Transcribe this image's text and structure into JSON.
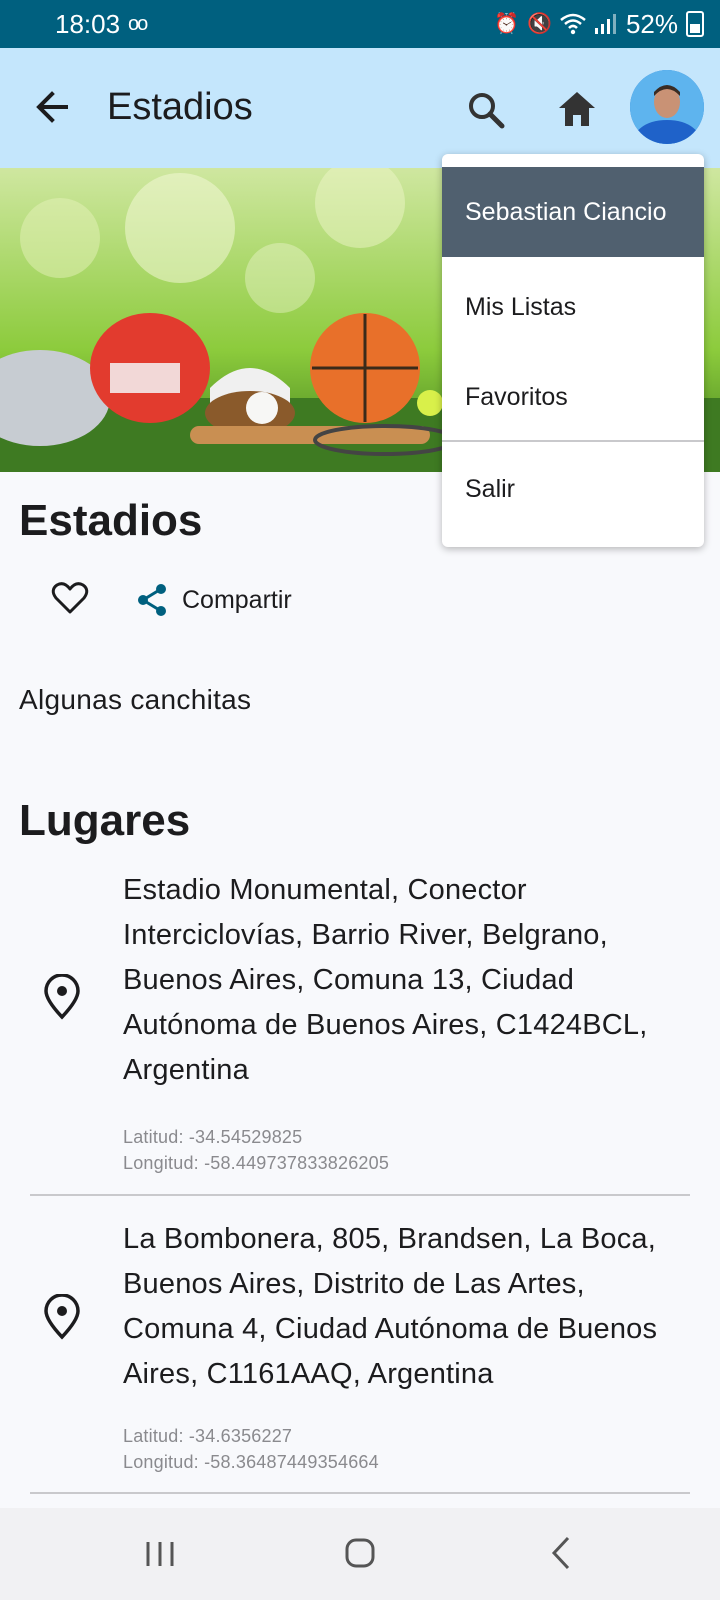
{
  "status_bar": {
    "time": "18:03",
    "battery": "52%"
  },
  "app_bar": {
    "title": "Estadios"
  },
  "list": {
    "title": "Estadios",
    "share_label": "Compartir",
    "description": "Algunas canchitas",
    "section_title": "Lugares"
  },
  "places": [
    {
      "address": "Estadio Monumental, Conector Interciclovías, Barrio River, Belgrano, Buenos Aires, Comuna 13, Ciudad Autónoma de Buenos Aires, C1424BCL, Argentina",
      "lat": "Latitud: -34.54529825",
      "lon": "Longitud: -58.449737833826205"
    },
    {
      "address": "La Bombonera, 805, Brandsen, La Boca, Buenos Aires, Distrito de Las Artes, Comuna 4, Ciudad Autónoma de Buenos Aires, C1161AAQ, Argentina",
      "lat": "Latitud: -34.6356227",
      "lon": "Longitud: -58.36487449354664"
    }
  ],
  "menu": {
    "user_name": "Sebastian Ciancio",
    "items": [
      "Mis Listas",
      "Favoritos",
      "Salir"
    ]
  },
  "colors": {
    "status_bar": "#00607f",
    "app_bar": "#c4e6fc",
    "menu_header": "#50606f",
    "accent": "#00607f"
  },
  "icons": [
    "back-arrow-icon",
    "search-icon",
    "home-icon",
    "heart-icon",
    "share-icon",
    "location-pin-icon"
  ]
}
